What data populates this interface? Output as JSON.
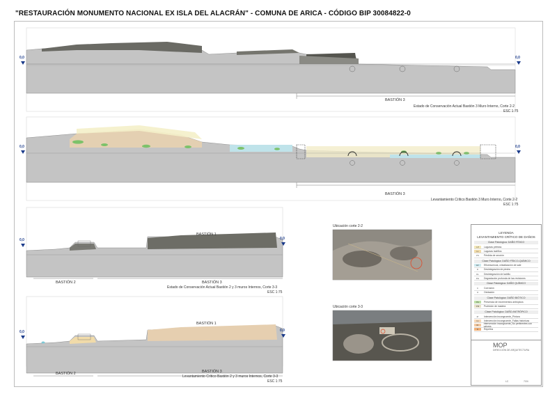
{
  "title": "\"RESTAURACIÓN MONUMENTO NACIONAL EX ISLA DEL ALACRÁN\" - COMUNA DE ARICA - CÓDIGO BIP 30084822-0",
  "level_mark": "0,0",
  "sections": [
    {
      "id": "s1",
      "bastion": "BASTIÓN 3",
      "caption": "Estado de Conservación Actual Bastión 3 Muro Interno, Corte 2-2",
      "scale": "ESC 1:75"
    },
    {
      "id": "s2",
      "bastion": "BASTIÓN 3",
      "caption": "Levantamiento Crítico Bastión 3 Muro Interno, Corte 2-2",
      "scale": "ESC 1:75"
    },
    {
      "id": "s3",
      "bastion_left": "BASTIÓN 2",
      "bastion_right": "BASTIÓN 3",
      "bastion_top": "BASTIÓN 1",
      "caption": "Estado de Conservación Actual Bastión 2 y 3 muros Internos, Corte 3-3",
      "scale": "ESC 1:75"
    },
    {
      "id": "s4",
      "bastion_left": "BASTIÓN 2",
      "bastion_right": "BASTIÓN 3",
      "bastion_top": "BASTIÓN 1",
      "caption": "Levantamiento Crítico Bastión 2 y 3 muros Internos, Corte 3-3",
      "scale": "ESC 1:75"
    }
  ],
  "locations": [
    {
      "label": "Ubicación corte 2-2"
    },
    {
      "label": "Ubicación corte 3-3"
    }
  ],
  "legend": {
    "title": "LEYENDA\nLEVANTAMIENTO CRÍTICO DE DAÑOS",
    "groups": [
      {
        "name": "Clase Patológica: DAÑO FÍSICO",
        "items": [
          {
            "code": "LP",
            "label": "Lagunas pétreas",
            "color": "#f3e7b8"
          },
          {
            "code": "LL",
            "label": "Lagunas ladrillos",
            "color": "#f1dba9"
          },
          {
            "code": "PS",
            "label": "Pérdida de sección",
            "color": "#ffffff"
          }
        ]
      },
      {
        "name": "Clase Patológica: DAÑO FÍSICO-QUÍMICO",
        "items": [
          {
            "code": "EF",
            "label": "Eflorescencia, cristalización de sale",
            "color": "#cde9ef"
          },
          {
            "code": "D",
            "label": "Desintegración de piedra",
            "color": "#ffffff"
          },
          {
            "code": "DL",
            "label": "Desintegración de ladrillo",
            "color": "#ffffff"
          },
          {
            "code": "DG",
            "label": "Degradación profunda de las revisiones",
            "color": "#ffffff"
          }
        ]
      },
      {
        "name": "Clase Patológica: DAÑO QUÍMICO",
        "items": [
          {
            "code": "C",
            "label": "Corrosión",
            "color": "#ffffff"
          },
          {
            "code": "O",
            "label": "Oxidación",
            "color": "#ffffff"
          }
        ]
      },
      {
        "name": "Clase Patológica: DAÑO BIÓTICO",
        "items": [
          {
            "code": "PA",
            "label": "Presencia de excrementos antrópicos",
            "color": "#bfe0a8"
          },
          {
            "code": "PM",
            "label": "Pudrición de madera",
            "color": "#e9e2c8"
          }
        ]
      },
      {
        "name": "Clase Patológica: DAÑO ANTRÓPICO",
        "items": [
          {
            "code": "IP",
            "label": "Intervención incongruente_Pintura",
            "color": "#ffffff"
          },
          {
            "code": "IH",
            "label": "Intervención incongruente_Fallas históricas",
            "color": "#f6d8b8"
          },
          {
            "code": "IR",
            "label": "Intervención incongruente_No pertinentes con valores",
            "color": "#f4c9a0"
          },
          {
            "code": "R",
            "label": "Repellos",
            "color": "#f2b27a"
          }
        ]
      }
    ]
  },
  "title_block": {
    "org": "MOP",
    "dept": "DIRECCIÓN DE ARQUITECTURA",
    "sheet_code": "LC",
    "sheet_num": "7/24"
  },
  "colors": {
    "level": "#1a3a8a",
    "section_fill": "#b8b8b8",
    "wall_dark": "#5a5a55",
    "damage_tan": "#e8d2b0",
    "damage_blue": "#bfe3ea",
    "damage_green": "#7cc26a"
  }
}
